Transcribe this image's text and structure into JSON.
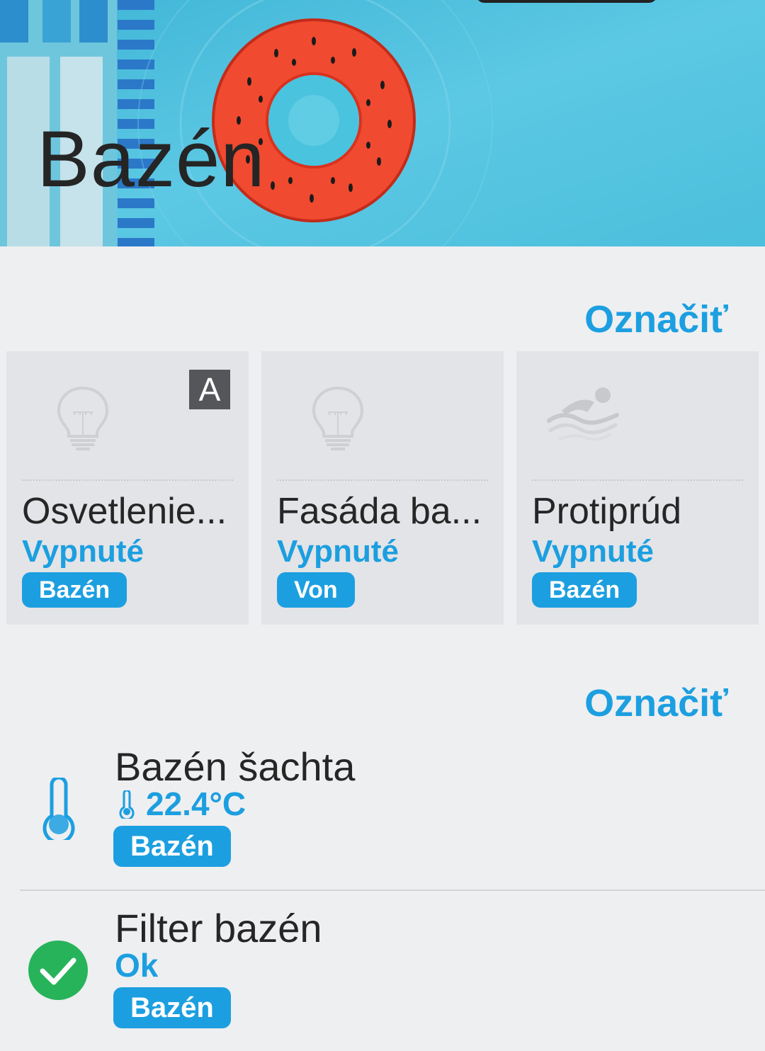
{
  "header": {
    "title": "Bazén"
  },
  "devices_section": {
    "select_label": "Označiť",
    "cards": [
      {
        "name": "Osvetlenie...",
        "state": "Vypnuté",
        "room": "Bazén",
        "icon": "light-bulb-icon",
        "auto_label": "A"
      },
      {
        "name": "Fasáda ba...",
        "state": "Vypnuté",
        "room": "Von",
        "icon": "light-bulb-icon"
      },
      {
        "name": "Protiprúd",
        "state": "Vypnuté",
        "room": "Bazén",
        "icon": "swimmer-icon"
      }
    ]
  },
  "sensors_section": {
    "select_label": "Označiť",
    "items": [
      {
        "name": "Bazén šachta",
        "value": "22.4°C",
        "room": "Bazén",
        "icon": "thermometer-icon"
      },
      {
        "name": "Filter bazén",
        "value": "Ok",
        "room": "Bazén",
        "icon": "check-circle-icon"
      }
    ]
  },
  "colors": {
    "accent": "#1c9fe0",
    "ok_green": "#27b35a",
    "background": "#eeeff1"
  }
}
